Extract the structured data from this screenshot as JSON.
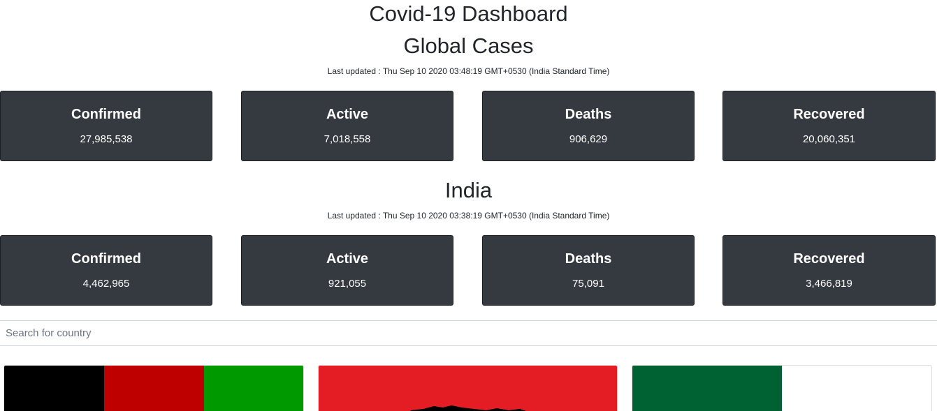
{
  "header": {
    "title": "Covid-19 Dashboard"
  },
  "global": {
    "title": "Global Cases",
    "last_updated": "Last updated : Thu Sep 10 2020 03:48:19 GMT+0530 (India Standard Time)",
    "stats": [
      {
        "label": "Confirmed",
        "value": "27,985,538"
      },
      {
        "label": "Active",
        "value": "7,018,558"
      },
      {
        "label": "Deaths",
        "value": "906,629"
      },
      {
        "label": "Recovered",
        "value": "20,060,351"
      }
    ]
  },
  "india": {
    "title": "India",
    "last_updated": "Last updated : Thu Sep 10 2020 03:38:19 GMT+0530 (India Standard Time)",
    "stats": [
      {
        "label": "Confirmed",
        "value": "4,462,965"
      },
      {
        "label": "Active",
        "value": "921,055"
      },
      {
        "label": "Deaths",
        "value": "75,091"
      },
      {
        "label": "Recovered",
        "value": "3,466,819"
      }
    ]
  },
  "search": {
    "placeholder": "Search for country"
  },
  "colors": {
    "card_bg": "#343a40",
    "card_text": "#ffffff",
    "flag1": [
      "#000000",
      "#be0000",
      "#009900"
    ],
    "flag2": "#e31d23",
    "flag3": [
      "#006233",
      "#ffffff"
    ]
  }
}
